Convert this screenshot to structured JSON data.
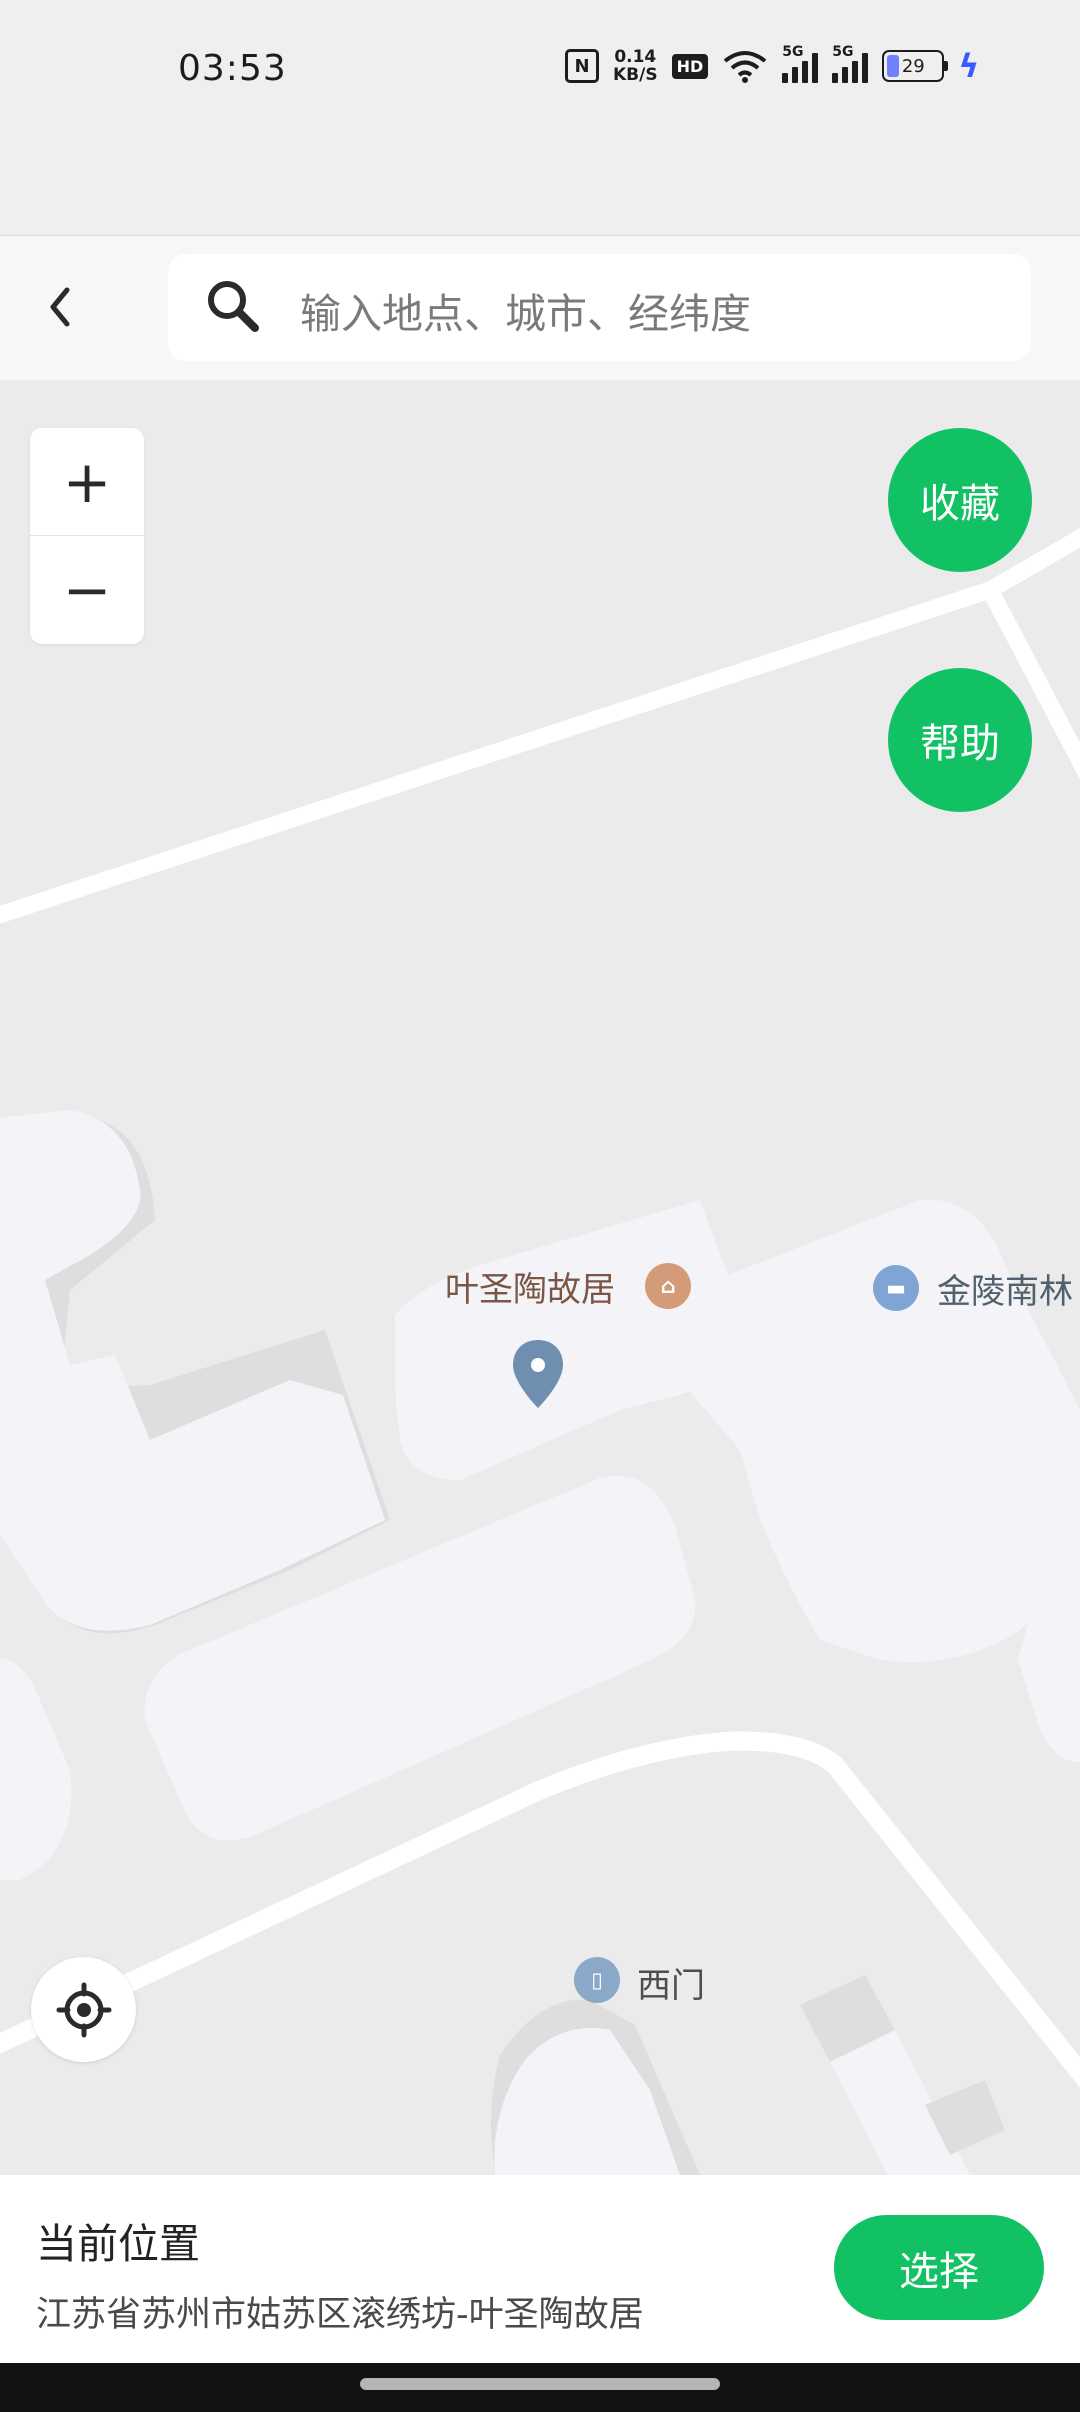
{
  "status_bar": {
    "time": "03:53",
    "nfc": "N",
    "network_speed_value": "0.14",
    "network_speed_unit": "KB/S",
    "hd": "HD",
    "signal_1": "5G",
    "signal_2": "5G",
    "battery": "29",
    "icons": [
      "nfc-icon",
      "wifi-icon",
      "signal-icon",
      "battery-icon",
      "charging-bolt-icon"
    ]
  },
  "header": {
    "search_placeholder": "输入地点、城市、经纬度"
  },
  "map": {
    "zoom_in": "+",
    "zoom_out": "−",
    "favorite_label": "收藏",
    "help_label": "帮助",
    "pois": {
      "residence": "叶圣陶故居",
      "hotel": "金陵南林",
      "gate": "西门"
    },
    "colors": {
      "accent": "#12c164",
      "marker": "#6f8fb1",
      "residence": "#d49b78",
      "hotel": "#7ea5d4"
    }
  },
  "bottom_panel": {
    "title": "当前位置",
    "address": "江苏省苏州市姑苏区滚绣坊-叶圣陶故居",
    "select_label": "选择"
  }
}
